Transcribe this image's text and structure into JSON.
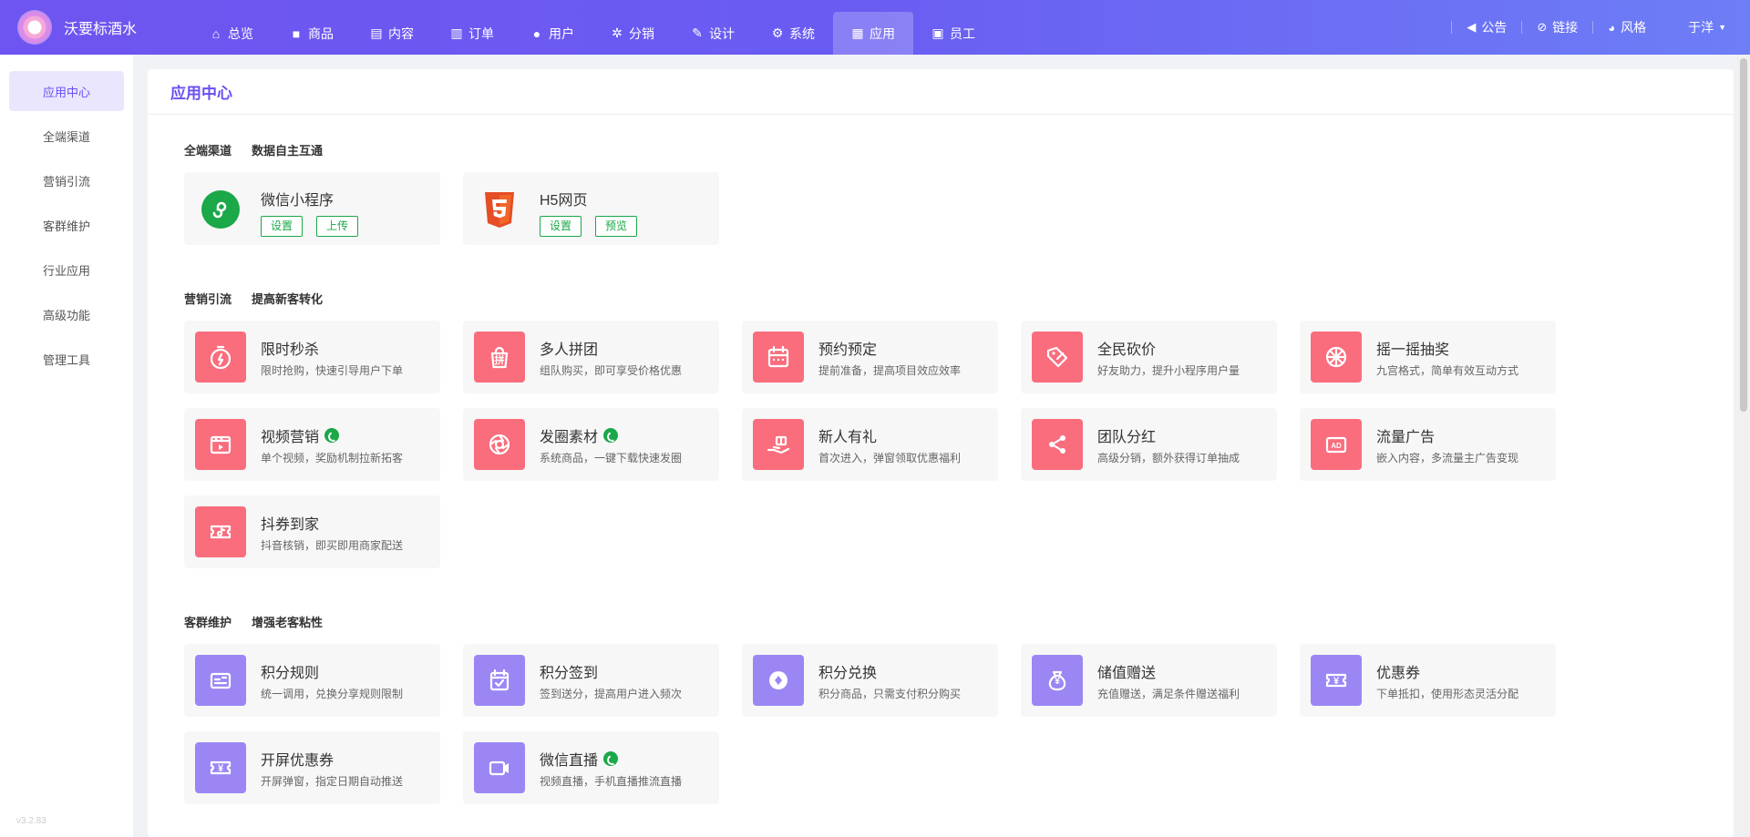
{
  "brand": {
    "name": "沃要标酒水"
  },
  "nav": [
    {
      "label": "总览",
      "icon": "home-icon",
      "glyph": "⌂"
    },
    {
      "label": "商品",
      "icon": "bag-icon",
      "glyph": "■"
    },
    {
      "label": "内容",
      "icon": "document-icon",
      "glyph": "▤"
    },
    {
      "label": "订单",
      "icon": "clipboard-icon",
      "glyph": "▥"
    },
    {
      "label": "用户",
      "icon": "user-icon",
      "glyph": "●"
    },
    {
      "label": "分销",
      "icon": "share-icon",
      "glyph": "✲"
    },
    {
      "label": "设计",
      "icon": "brush-icon",
      "glyph": "✎"
    },
    {
      "label": "系统",
      "icon": "gear-icon",
      "glyph": "⚙"
    },
    {
      "label": "应用",
      "icon": "grid-icon",
      "glyph": "▦",
      "active": true
    },
    {
      "label": "员工",
      "icon": "lock-icon",
      "glyph": "▣"
    }
  ],
  "tools": [
    {
      "label": "公告",
      "icon": "megaphone-icon",
      "glyph": "◀"
    },
    {
      "label": "链接",
      "icon": "link-icon",
      "glyph": "⊘"
    },
    {
      "label": "风格",
      "icon": "palette-icon",
      "glyph": "◕"
    }
  ],
  "user": {
    "name": "于洋",
    "caret": "▼"
  },
  "sidebar": [
    {
      "label": "应用中心",
      "active": true
    },
    {
      "label": "全端渠道"
    },
    {
      "label": "营销引流"
    },
    {
      "label": "客群维护"
    },
    {
      "label": "行业应用"
    },
    {
      "label": "高级功能"
    },
    {
      "label": "管理工具"
    }
  ],
  "version": "v3.2.83",
  "panel_title": "应用中心",
  "sections": {
    "channels": {
      "title": "全端渠道",
      "subtitle": "数据自主互通"
    },
    "marketing": {
      "title": "营销引流",
      "subtitle": "提高新客转化"
    },
    "retention": {
      "title": "客群维护",
      "subtitle": "增强老客粘性"
    }
  },
  "channels": [
    {
      "title": "微信小程序",
      "icon": "wechat-miniprogram-icon",
      "buttons": [
        "设置",
        "上传"
      ]
    },
    {
      "title": "H5网页",
      "icon": "html5-icon",
      "buttons": [
        "设置",
        "预览"
      ]
    }
  ],
  "marketing": [
    {
      "title": "限时秒杀",
      "desc": "限时抢购，快速引导用户下单",
      "icon": "stopwatch-icon"
    },
    {
      "title": "多人拼团",
      "desc": "组队购买，即可享受价格优惠",
      "icon": "group-buy-icon",
      "glyph": "拼"
    },
    {
      "title": "预约预定",
      "desc": "提前准备，提高项目效应效率",
      "icon": "calendar-icon"
    },
    {
      "title": "全民砍价",
      "desc": "好友助力，提升小程序用户量",
      "icon": "price-tag-icon"
    },
    {
      "title": "摇一摇抽奖",
      "desc": "九宫格式，简单有效互动方式",
      "icon": "wheel-icon"
    },
    {
      "title": "视频营销",
      "desc": "单个视频，奖励机制拉新拓客",
      "icon": "video-icon",
      "badge": true
    },
    {
      "title": "发圈素材",
      "desc": "系统商品，一键下载快速发圈",
      "icon": "aperture-icon",
      "badge": true
    },
    {
      "title": "新人有礼",
      "desc": "首次进入，弹窗领取优惠福利",
      "icon": "gift-hand-icon"
    },
    {
      "title": "团队分红",
      "desc": "高级分销，额外获得订单抽成",
      "icon": "share-nodes-icon"
    },
    {
      "title": "流量广告",
      "desc": "嵌入内容，多流量主广告变现",
      "icon": "ad-icon",
      "glyph": "AD"
    },
    {
      "title": "抖券到家",
      "desc": "抖音核销，即买即用商家配送",
      "icon": "douyin-ticket-icon"
    }
  ],
  "retention": [
    {
      "title": "积分规则",
      "desc": "统一调用，兑换分享规则限制",
      "icon": "rules-card-icon"
    },
    {
      "title": "积分签到",
      "desc": "签到送分，提高用户进入频次",
      "icon": "checkin-calendar-icon"
    },
    {
      "title": "积分兑换",
      "desc": "积分商品，只需支付积分购买",
      "icon": "diamond-coin-icon"
    },
    {
      "title": "储值赠送",
      "desc": "充值赠送，满足条件赠送福利",
      "icon": "money-bag-icon",
      "glyph": "¥"
    },
    {
      "title": "优惠券",
      "desc": "下单抵扣，使用形态灵活分配",
      "icon": "coupon-icon",
      "glyph": "¥"
    },
    {
      "title": "开屏优惠券",
      "desc": "开屏弹窗，指定日期自动推送",
      "icon": "screen-coupon-icon",
      "glyph": "¥"
    },
    {
      "title": "微信直播",
      "desc": "视频直播，手机直播推流直播",
      "icon": "live-camera-icon",
      "badge": true
    }
  ],
  "colors": {
    "primary": "#6a4ff0",
    "marketing_icon": "#f96d7d",
    "retention_icon": "#9c86f4",
    "wechat_green": "#1aa848"
  }
}
